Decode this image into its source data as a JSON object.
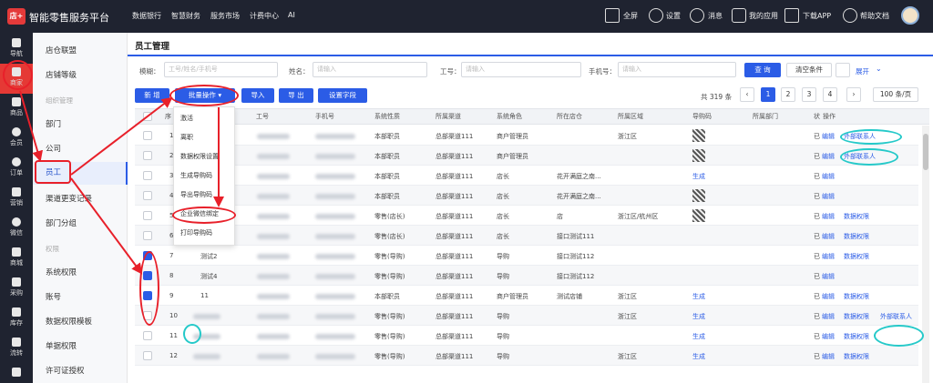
{
  "app": {
    "title": "智能零售服务平台",
    "logo": "店+"
  },
  "topnav": [
    "数据银行",
    "智慧财务",
    "服务市场",
    "计费中心",
    "AI"
  ],
  "topright": [
    "全屏",
    "设置",
    "消息",
    "我的应用",
    "下载APP",
    "帮助文档"
  ],
  "rail": [
    {
      "label": "导航",
      "icon": "menu-icon"
    },
    {
      "label": "商家",
      "icon": "home-icon"
    },
    {
      "label": "商品",
      "icon": "grid-icon"
    },
    {
      "label": "会员",
      "icon": "user-icon"
    },
    {
      "label": "订单",
      "icon": "pie-icon"
    },
    {
      "label": "营销",
      "icon": "megaphone-icon"
    },
    {
      "label": "微信",
      "icon": "wechat-icon"
    },
    {
      "label": "商城",
      "icon": "shop-icon"
    },
    {
      "label": "采购",
      "icon": "truck-icon"
    },
    {
      "label": "库存",
      "icon": "box-icon"
    },
    {
      "label": "流转",
      "icon": "flow-icon"
    },
    {
      "label": "",
      "icon": "list-icon"
    }
  ],
  "submenu": [
    {
      "label": "店仓联盟",
      "type": "item"
    },
    {
      "label": "店铺等级",
      "type": "item"
    },
    {
      "label": "组织管理",
      "type": "group"
    },
    {
      "label": "部门",
      "type": "item"
    },
    {
      "label": "公司",
      "type": "item"
    },
    {
      "label": "员工",
      "type": "active"
    },
    {
      "label": "渠道更变记录",
      "type": "item"
    },
    {
      "label": "部门分组",
      "type": "item"
    },
    {
      "label": "权限",
      "type": "group"
    },
    {
      "label": "系统权限",
      "type": "item"
    },
    {
      "label": "账号",
      "type": "item"
    },
    {
      "label": "数据权限模板",
      "type": "item"
    },
    {
      "label": "单据权限",
      "type": "item"
    },
    {
      "label": "许可证授权",
      "type": "item"
    }
  ],
  "page_title": "员工管理",
  "filters": {
    "fuzzy_label": "模糊：",
    "fuzzy_placeholder": "工号/姓名/手机号",
    "name_label": "姓名：",
    "name_placeholder": "请输入",
    "id_label": "工号：",
    "id_placeholder": "请输入",
    "phone_label": "手机号：",
    "phone_placeholder": "请输入",
    "query": "查 询",
    "clear": "清空条件",
    "expand": "展开"
  },
  "toolbar": {
    "new": "新 增",
    "batch": "批量操作",
    "import": "导入",
    "export": "导 出",
    "settings": "设置字段",
    "total": "共 319 条",
    "pages": [
      "1",
      "2",
      "3",
      "4"
    ],
    "page_size": "100 条/页"
  },
  "batch_menu": [
    "激活",
    "离职",
    "数据权限设置",
    "生成导购码",
    "导出导购码",
    "企业微信绑定",
    "打印导购码"
  ],
  "columns": [
    "序",
    "",
    "工号",
    "手机号",
    "系统性质",
    "所属渠道",
    "系统角色",
    "所在店仓",
    "所属区域",
    "导购码",
    "所属部门",
    "状",
    "操作"
  ],
  "rows": [
    {
      "no": "1",
      "name": "",
      "nature": "本部职员",
      "channel": "总部渠道111",
      "role": "商户管理员",
      "store": "",
      "region": "浙江区",
      "code": "qr",
      "status": "已",
      "ops": [
        "编辑",
        "外部联系人"
      ],
      "checked": false
    },
    {
      "no": "2",
      "name": "",
      "nature": "本部职员",
      "channel": "总部渠道111",
      "role": "商户管理员",
      "store": "",
      "region": "",
      "code": "qr",
      "status": "已",
      "ops": [
        "编辑",
        "外部联系人"
      ],
      "checked": false
    },
    {
      "no": "3",
      "name": "",
      "nature": "本部职员",
      "channel": "总部渠道111",
      "role": "店长",
      "store": "花开满庭之南...",
      "region": "",
      "code": "生成",
      "status": "已",
      "ops": [
        "编辑"
      ],
      "checked": false
    },
    {
      "no": "4",
      "name": "",
      "nature": "本部职员",
      "channel": "总部渠道111",
      "role": "店长",
      "store": "花开满庭之南...",
      "region": "",
      "code": "qr",
      "status": "已",
      "ops": [
        "编辑"
      ],
      "checked": false
    },
    {
      "no": "5",
      "name": "",
      "nature": "零售(店长)",
      "channel": "总部渠道111",
      "role": "店长",
      "store": "店",
      "region": "浙江区/杭州区",
      "code": "qr",
      "status": "已",
      "ops": [
        "编辑",
        "数据权限"
      ],
      "checked": false
    },
    {
      "no": "6",
      "name": "测试3",
      "nature": "零售(店长)",
      "channel": "总部渠道111",
      "role": "店长",
      "store": "接口测试111",
      "region": "",
      "code": "",
      "status": "已",
      "ops": [
        "编辑",
        "数据权限"
      ],
      "checked": false
    },
    {
      "no": "7",
      "name": "测试2",
      "nature": "零售(导购)",
      "channel": "总部渠道111",
      "role": "导购",
      "store": "接口测试112",
      "region": "",
      "code": "",
      "status": "已",
      "ops": [
        "编辑",
        "数据权限"
      ],
      "checked": true
    },
    {
      "no": "8",
      "name": "测试4",
      "nature": "零售(导购)",
      "channel": "总部渠道111",
      "role": "导购",
      "store": "接口测试112",
      "region": "",
      "code": "",
      "status": "已",
      "ops": [
        "编辑"
      ],
      "checked": true
    },
    {
      "no": "9",
      "name": "11",
      "nature": "本部职员",
      "channel": "总部渠道111",
      "role": "商户管理员",
      "store": "测试店铺",
      "region": "浙江区",
      "code": "生成",
      "status": "已",
      "ops": [
        "编辑",
        "数据权限"
      ],
      "checked": true
    },
    {
      "no": "10",
      "name": "",
      "nature": "零售(导购)",
      "channel": "总部渠道111",
      "role": "导购",
      "store": "",
      "region": "浙江区",
      "code": "生成",
      "status": "已",
      "ops": [
        "编辑",
        "数据权限",
        "外部联系人"
      ],
      "checked": false
    },
    {
      "no": "11",
      "name": "",
      "nature": "零售(导购)",
      "channel": "总部渠道111",
      "role": "导购",
      "store": "",
      "region": "",
      "code": "生成",
      "status": "已",
      "ops": [
        "编辑",
        "数据权限"
      ],
      "checked": false
    },
    {
      "no": "12",
      "name": "",
      "nature": "零售(导购)",
      "channel": "总部渠道111",
      "role": "导购",
      "store": "",
      "region": "浙江区",
      "code": "生成",
      "status": "已",
      "ops": [
        "编辑",
        "数据权限"
      ],
      "checked": false
    }
  ],
  "colors": {
    "accent": "#2b5ce6",
    "rail_active": "#e53935",
    "annotation_red": "#e8202a",
    "annotation_cyan": "#25c9c9"
  }
}
